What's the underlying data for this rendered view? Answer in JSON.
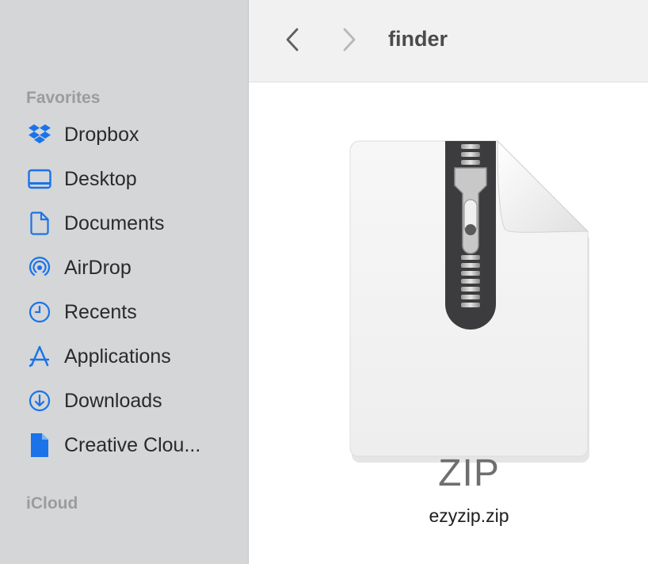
{
  "toolbar": {
    "title": "finder",
    "back_icon": "chevron-left-icon",
    "forward_icon": "chevron-right-icon"
  },
  "sidebar": {
    "favorites_header": "Favorites",
    "icloud_header": "iCloud",
    "accent_color": "#1a73e8",
    "items": [
      {
        "label": "Dropbox",
        "icon": "dropbox-icon"
      },
      {
        "label": "Desktop",
        "icon": "desktop-icon"
      },
      {
        "label": "Documents",
        "icon": "document-icon"
      },
      {
        "label": "AirDrop",
        "icon": "airdrop-icon"
      },
      {
        "label": "Recents",
        "icon": "clock-icon"
      },
      {
        "label": "Applications",
        "icon": "applications-icon"
      },
      {
        "label": "Downloads",
        "icon": "download-icon"
      },
      {
        "label": "Creative Clou...",
        "icon": "file-icon"
      }
    ]
  },
  "content": {
    "file": {
      "icon_badge": "ZIP",
      "name": "ezyzip.zip",
      "icon": "zip-archive-icon"
    }
  }
}
